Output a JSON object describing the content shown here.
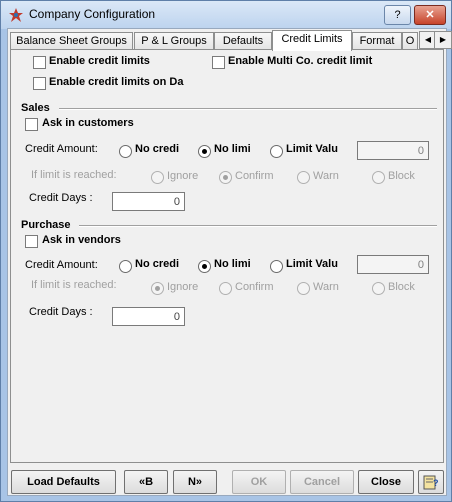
{
  "window": {
    "title": "Company Configuration",
    "help_glyph": "?",
    "close_glyph": "✕"
  },
  "tabs": [
    {
      "label": "Balance Sheet Groups"
    },
    {
      "label": "P & L Groups"
    },
    {
      "label": "Defaults"
    },
    {
      "label": "Credit Limits",
      "active": true
    },
    {
      "label": "Format"
    },
    {
      "label": "O"
    }
  ],
  "tab_scroll": {
    "left": "◀",
    "right": "▶"
  },
  "general": {
    "enable_credit_limits": "Enable credit limits",
    "enable_multi_co": "Enable Multi Co. credit limit",
    "enable_on_da": "Enable credit limits on Da"
  },
  "sales": {
    "heading": "Sales",
    "ask_label": "Ask in customers",
    "credit_amount_label": "Credit Amount:",
    "options": [
      "No credi",
      "No limi",
      "Limit Valu"
    ],
    "selected": "No limi",
    "limit_value": "0",
    "limit_reached_label": "If limit is reached:",
    "reached_options": [
      "Ignore",
      "Confirm",
      "Warn",
      "Block"
    ],
    "reached_selected": "Confirm",
    "credit_days_label": "Credit Days    :",
    "credit_days": "0"
  },
  "purchase": {
    "heading": "Purchase",
    "ask_label": "Ask in vendors",
    "credit_amount_label": "Credit Amount:",
    "options": [
      "No credi",
      "No limi",
      "Limit Valu"
    ],
    "selected": "No limi",
    "limit_value": "0",
    "limit_reached_label": "If limit is reached:",
    "reached_options": [
      "Ignore",
      "Confirm",
      "Warn",
      "Block"
    ],
    "reached_selected": "Ignore",
    "credit_days_label": "Credit Days    :",
    "credit_days": "0"
  },
  "buttons": {
    "load_defaults": "Load Defaults",
    "back": "«B",
    "next": "N»",
    "ok": "OK",
    "cancel": "Cancel",
    "close": "Close"
  },
  "colors": {
    "titlebar": "#bcd3ee",
    "close_button": "#c7432a",
    "face": "#f0f0f0"
  }
}
